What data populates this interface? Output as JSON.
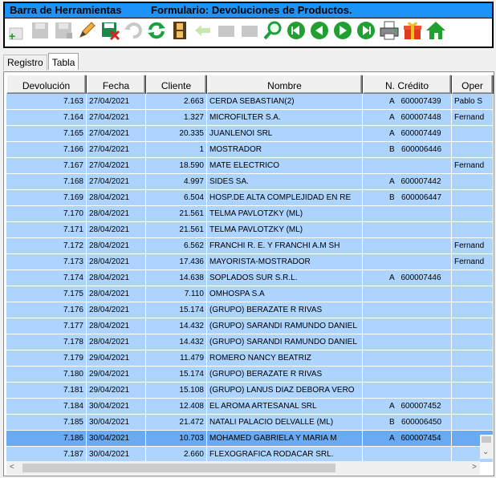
{
  "window": {
    "toolbar_title": "Barra de Herramientas",
    "form_title": "Formulario: Devoluciones de Productos."
  },
  "toolbar": {
    "buttons": [
      {
        "icon": "add-icon"
      },
      {
        "icon": "save-disabled-icon"
      },
      {
        "icon": "save-all-disabled-icon"
      },
      {
        "icon": "edit-pencil-icon"
      },
      {
        "icon": "delete-icon"
      },
      {
        "icon": "undo-disabled-icon"
      },
      {
        "icon": "refresh-icon"
      },
      {
        "icon": "film-icon"
      },
      {
        "icon": "back-disabled-icon"
      },
      {
        "icon": "blank-disabled-icon"
      },
      {
        "icon": "blank2-disabled-icon"
      },
      {
        "icon": "search-icon"
      },
      {
        "icon": "first-record-icon"
      },
      {
        "icon": "previous-record-icon"
      },
      {
        "icon": "next-record-icon"
      },
      {
        "icon": "last-record-icon"
      },
      {
        "icon": "printer-icon"
      },
      {
        "icon": "gift-icon"
      },
      {
        "icon": "home-icon"
      }
    ]
  },
  "tabs": [
    {
      "label": "Registro"
    },
    {
      "label": "Tabla"
    }
  ],
  "table": {
    "columns": [
      "Devolución",
      "Fecha",
      "Cliente",
      "Nombre",
      "N. Crédito",
      "Oper"
    ],
    "rows": [
      {
        "dev": "7.163",
        "fecha": "27/04/2021",
        "cliente": "2.663",
        "nombre": "CERDA SEBASTIAN(2)",
        "tipo": "A",
        "credito": "600007439",
        "oper": "Pablo S"
      },
      {
        "dev": "7.164",
        "fecha": "27/04/2021",
        "cliente": "1.327",
        "nombre": "MICROFILTER S.A.",
        "tipo": "A",
        "credito": "600007448",
        "oper": "Fernand"
      },
      {
        "dev": "7.165",
        "fecha": "27/04/2021",
        "cliente": "20.335",
        "nombre": "JUANLENOI SRL",
        "tipo": "A",
        "credito": "600007449",
        "oper": ""
      },
      {
        "dev": "7.166",
        "fecha": "27/04/2021",
        "cliente": "1",
        "nombre": "MOSTRADOR",
        "tipo": "B",
        "credito": "600006446",
        "oper": ""
      },
      {
        "dev": "7.167",
        "fecha": "27/04/2021",
        "cliente": "18.590",
        "nombre": "MATE ELECTRICO",
        "tipo": "",
        "credito": "",
        "oper": "Fernand"
      },
      {
        "dev": "7.168",
        "fecha": "27/04/2021",
        "cliente": "4.997",
        "nombre": "SIDES SA.",
        "tipo": "A",
        "credito": "600007442",
        "oper": ""
      },
      {
        "dev": "7.169",
        "fecha": "28/04/2021",
        "cliente": "6.504",
        "nombre": "HOSP.DE ALTA COMPLEJIDAD EN RE",
        "tipo": "B",
        "credito": "600006447",
        "oper": ""
      },
      {
        "dev": "7.170",
        "fecha": "28/04/2021",
        "cliente": "21.561",
        "nombre": "TELMA PAVLOTZKY (ML)",
        "tipo": "",
        "credito": "",
        "oper": ""
      },
      {
        "dev": "7.171",
        "fecha": "28/04/2021",
        "cliente": "21.561",
        "nombre": "TELMA PAVLOTZKY (ML)",
        "tipo": "",
        "credito": "",
        "oper": ""
      },
      {
        "dev": "7.172",
        "fecha": "28/04/2021",
        "cliente": "6.562",
        "nombre": "FRANCHI R. E. Y FRANCHI A.M SH",
        "tipo": "",
        "credito": "",
        "oper": "Fernand"
      },
      {
        "dev": "7.173",
        "fecha": "28/04/2021",
        "cliente": "17.436",
        "nombre": "MAYORISTA-MOSTRADOR",
        "tipo": "",
        "credito": "",
        "oper": "Fernand"
      },
      {
        "dev": "7.174",
        "fecha": "28/04/2021",
        "cliente": "14.638",
        "nombre": "SOPLADOS SUR S.R.L.",
        "tipo": "A",
        "credito": "600007446",
        "oper": ""
      },
      {
        "dev": "7.175",
        "fecha": "28/04/2021",
        "cliente": "7.110",
        "nombre": "OMHOSPA S.A",
        "tipo": "",
        "credito": "",
        "oper": ""
      },
      {
        "dev": "7.176",
        "fecha": "28/04/2021",
        "cliente": "15.174",
        "nombre": "(GRUPO) BERAZATE R RIVAS",
        "tipo": "",
        "credito": "",
        "oper": ""
      },
      {
        "dev": "7.177",
        "fecha": "28/04/2021",
        "cliente": "14.432",
        "nombre": "(GRUPO) SARANDI RAMUNDO DANIEL",
        "tipo": "",
        "credito": "",
        "oper": ""
      },
      {
        "dev": "7.178",
        "fecha": "28/04/2021",
        "cliente": "14.432",
        "nombre": "(GRUPO) SARANDI RAMUNDO DANIEL",
        "tipo": "",
        "credito": "",
        "oper": ""
      },
      {
        "dev": "7.179",
        "fecha": "29/04/2021",
        "cliente": "11.479",
        "nombre": " ROMERO NANCY BEATRIZ",
        "tipo": "",
        "credito": "",
        "oper": ""
      },
      {
        "dev": "7.180",
        "fecha": "29/04/2021",
        "cliente": "15.174",
        "nombre": "(GRUPO) BERAZATE R RIVAS",
        "tipo": "",
        "credito": "",
        "oper": ""
      },
      {
        "dev": "7.181",
        "fecha": "29/04/2021",
        "cliente": "15.108",
        "nombre": "(GRUPO) LANUS DIAZ DEBORA VERO",
        "tipo": "",
        "credito": "",
        "oper": ""
      },
      {
        "dev": "7.184",
        "fecha": "30/04/2021",
        "cliente": "12.408",
        "nombre": "EL AROMA ARTESANAL SRL",
        "tipo": "A",
        "credito": "600007452",
        "oper": ""
      },
      {
        "dev": "7.185",
        "fecha": "30/04/2021",
        "cliente": "21.472",
        "nombre": "NATALI PALACIO DELVALLE (ML)",
        "tipo": "B",
        "credito": "600006450",
        "oper": ""
      },
      {
        "dev": "7.186",
        "fecha": "30/04/2021",
        "cliente": "10.703",
        "nombre": "MOHAMED GABRIELA Y MARIA M",
        "tipo": "A",
        "credito": "600007454",
        "oper": "",
        "selected": true
      },
      {
        "dev": "7.187",
        "fecha": "30/04/2021",
        "cliente": "2.660",
        "nombre": "FLEXOGRAFICA RODACAR SRL.",
        "tipo": "",
        "credito": "",
        "oper": ""
      }
    ]
  }
}
